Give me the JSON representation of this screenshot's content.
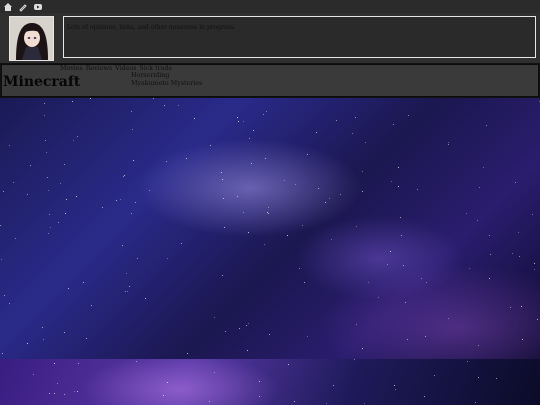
{
  "topbar": {
    "icons": [
      "home-icon",
      "edit-icon",
      "play-icon"
    ]
  },
  "header": {
    "description": "Lots of opinions, links, and other nonsense in progress."
  },
  "infobar": {
    "title": "Minecraft",
    "tags": [
      "Movies",
      "Reviews",
      "Videos",
      "Sick trade"
    ],
    "subitems": [
      "Horseriding",
      "Myakumoto Mysteries"
    ]
  },
  "colors": {
    "topbar": "#2b2b2b",
    "header": "#2f2f2f",
    "infobar": "#3a3a3a"
  }
}
